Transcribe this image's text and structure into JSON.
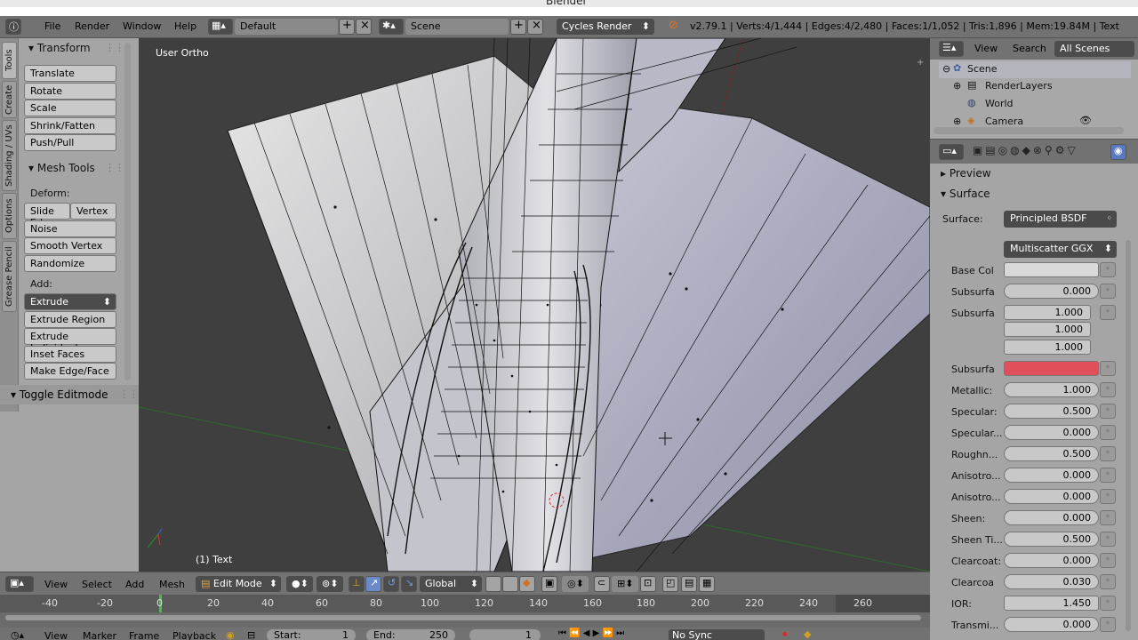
{
  "window": {
    "title": "Blender"
  },
  "infobar": {
    "menus": [
      "File",
      "Render",
      "Window",
      "Help"
    ],
    "screen_layout": "Default",
    "scene": "Scene",
    "engine": "Cycles Render",
    "stats": "v2.79.1 | Verts:4/1,444 | Edges:4/2,480 | Faces:1/1,052 | Tris:1,896 | Mem:19.84M | Text"
  },
  "toolshelf": {
    "tabs": [
      "Tools",
      "Create",
      "Shading / UVs",
      "Options",
      "Grease Pencil"
    ],
    "transform": {
      "title": "Transform",
      "buttons": [
        "Translate",
        "Rotate",
        "Scale",
        "Shrink/Fatten",
        "Push/Pull"
      ]
    },
    "mesh_tools": {
      "title": "Mesh Tools",
      "deform_label": "Deform:",
      "slide_edge": "Slide Ed",
      "vertex": "Vertex",
      "deform_buttons": [
        "Noise",
        "Smooth Vertex",
        "Randomize"
      ],
      "add_label": "Add:",
      "extrude": "Extrude",
      "add_buttons": [
        "Extrude Region",
        "Extrude Individual",
        "Inset Faces",
        "Make Edge/Face"
      ]
    },
    "toggle_editmode": "Toggle Editmode"
  },
  "viewport": {
    "view_label": "User Ortho",
    "object_label": "(1) Text"
  },
  "viewport_header": {
    "menus": [
      "View",
      "Select",
      "Add",
      "Mesh"
    ],
    "mode": "Edit Mode",
    "orientation": "Global"
  },
  "timeline": {
    "ticks": [
      "-40",
      "-20",
      "0",
      "20",
      "40",
      "60",
      "80",
      "100",
      "120",
      "140",
      "160",
      "180",
      "200",
      "220",
      "240",
      "260"
    ],
    "menus": [
      "View",
      "Marker",
      "Frame",
      "Playback"
    ],
    "start_label": "Start:",
    "start_value": "1",
    "end_label": "End:",
    "end_value": "250",
    "current_frame": "1",
    "sync": "No Sync"
  },
  "outliner": {
    "menus": [
      "View",
      "Search"
    ],
    "filter": "All Scenes",
    "items": [
      "Scene",
      "RenderLayers",
      "World",
      "Camera"
    ]
  },
  "properties": {
    "preview": "Preview",
    "surface_panel": "Surface",
    "surface_label": "Surface:",
    "surface_value": "Principled BSDF",
    "distribution": "Multiscatter GGX",
    "base_color_label": "Base Col",
    "subsurface_label": "Subsurfa",
    "subsurface_value": "0.000",
    "subsurface_radius_label": "Subsurfa",
    "subsurface_radius": [
      "1.000",
      "1.000",
      "1.000"
    ],
    "subsurface_color_label": "Subsurfa",
    "subsurface_color": "#e0505a",
    "rows": [
      {
        "label": "Metallic:",
        "value": "1.000"
      },
      {
        "label": "Specular:",
        "value": "0.500"
      },
      {
        "label": "Specular...",
        "value": "0.000"
      },
      {
        "label": "Roughn...",
        "value": "0.500"
      },
      {
        "label": "Anisotro...",
        "value": "0.000"
      },
      {
        "label": "Anisotro...",
        "value": "0.000"
      },
      {
        "label": "Sheen:",
        "value": "0.000"
      },
      {
        "label": "Sheen Ti...",
        "value": "0.500"
      },
      {
        "label": "Clearcoat:",
        "value": "0.000"
      },
      {
        "label": "Clearcoa",
        "value": "0.030"
      },
      {
        "label": "IOR:",
        "value": "1.450"
      },
      {
        "label": "Transmi...",
        "value": "0.000"
      }
    ]
  }
}
